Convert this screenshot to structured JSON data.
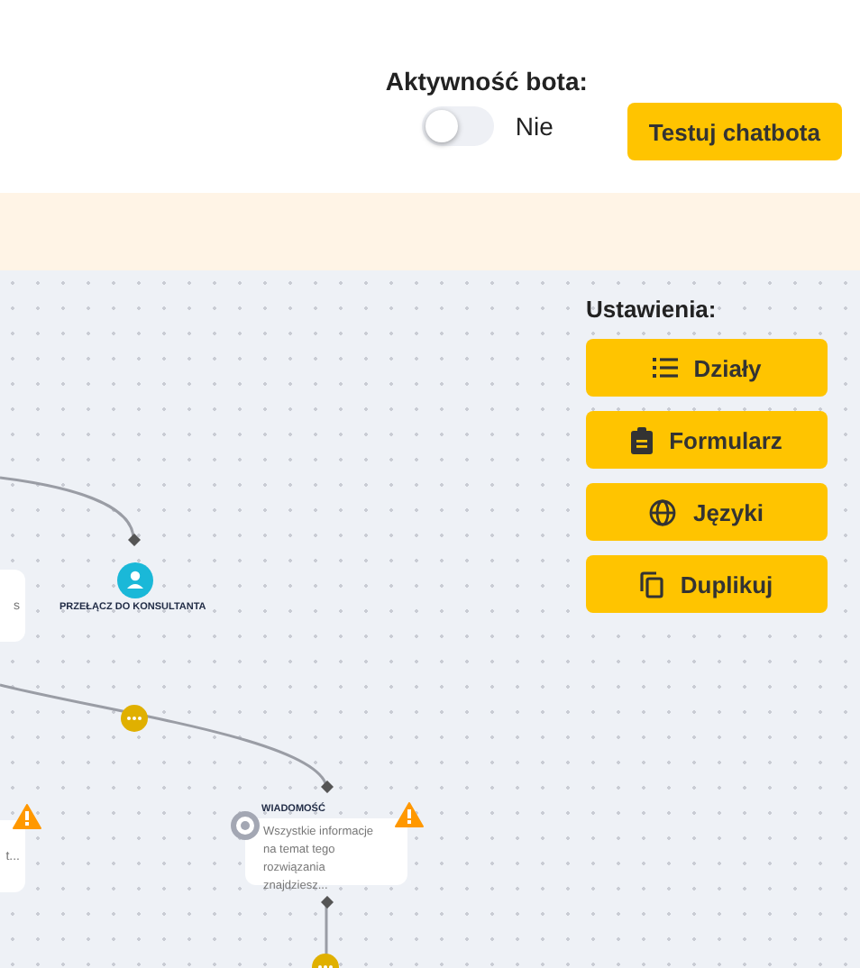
{
  "header": {
    "bot_activity": {
      "label": "Aktywność bota:",
      "toggle": {
        "on": false
      },
      "state_label": "Nie"
    },
    "test_button": "Testuj chatbota"
  },
  "canvas": {
    "nodes": [
      {
        "kind": "card",
        "text": "s"
      },
      {
        "kind": "card",
        "text": "t...",
        "warning": true
      },
      {
        "kind": "agent",
        "title": "PRZEŁĄCZ DO KONSULTANTA"
      },
      {
        "kind": "message",
        "title": "WIADOMOŚĆ",
        "text": "Wszystkie informacje na temat tego rozwiązania znajdziesz...",
        "warning": true
      }
    ]
  },
  "settings": {
    "title": "Ustawienia:",
    "buttons": [
      {
        "label": "Działy",
        "kind": "list"
      },
      {
        "label": "Formularz",
        "kind": "clipboard"
      },
      {
        "label": "Języki",
        "kind": "globe"
      },
      {
        "label": "Duplikuj",
        "kind": "copy"
      }
    ]
  }
}
